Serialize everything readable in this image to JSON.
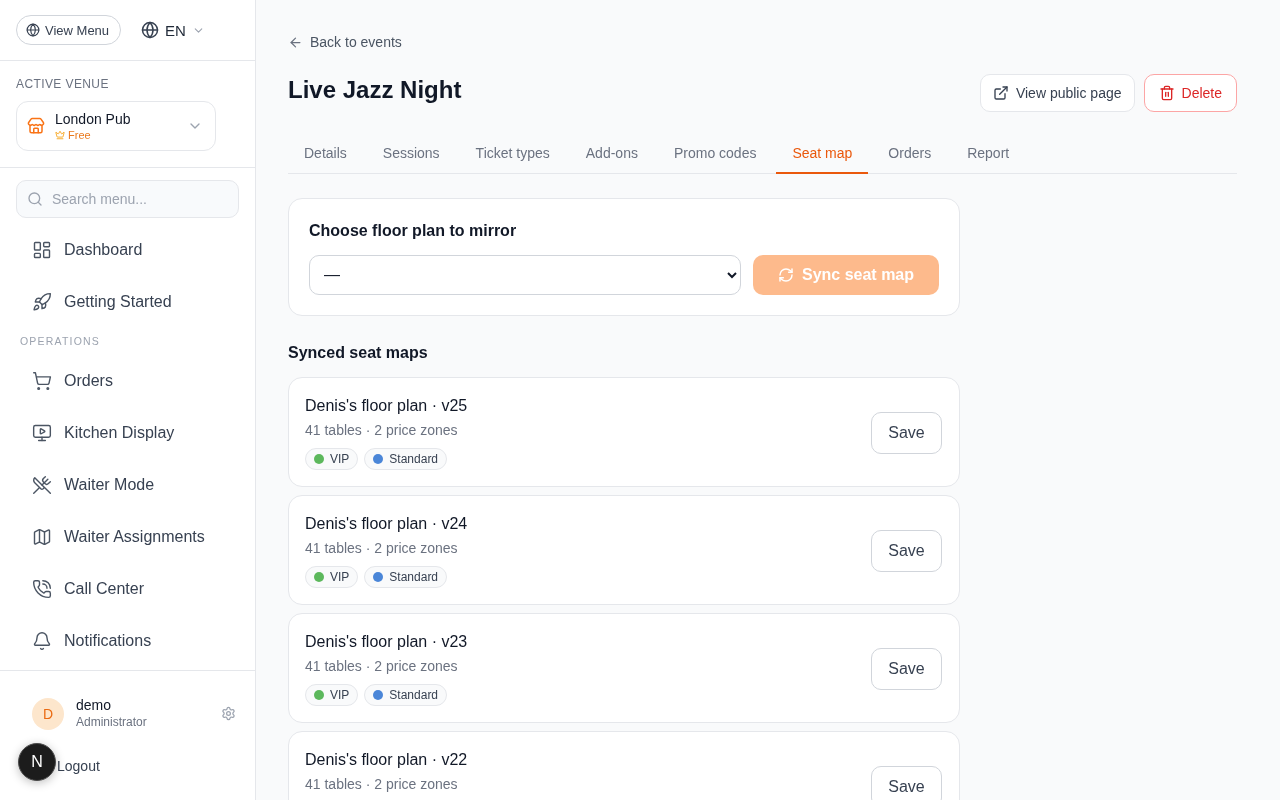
{
  "sidebar": {
    "view_menu_button": {
      "label": "View Menu"
    },
    "language": {
      "label": "EN"
    },
    "venue": {
      "heading": "ACTIVE VENUE",
      "name": "London Pub",
      "plan": "Free"
    },
    "search": {
      "placeholder": "Search menu..."
    },
    "sections": [
      {
        "items": [
          {
            "label": "Dashboard",
            "selected": false
          },
          {
            "label": "Getting Started",
            "selected": false
          }
        ]
      },
      {
        "heading": "OPERATIONS",
        "items": [
          {
            "label": "Orders",
            "selected": false
          },
          {
            "label": "Kitchen Display",
            "selected": false
          },
          {
            "label": "Waiter Mode",
            "selected": false
          },
          {
            "label": "Waiter Assignments",
            "selected": false
          },
          {
            "label": "Call Center",
            "selected": false
          },
          {
            "label": "Notifications",
            "selected": false
          }
        ]
      }
    ],
    "user": {
      "initial": "D",
      "name": "demo",
      "role": "Administrator"
    },
    "logout": {
      "label": "Logout"
    }
  },
  "dev_badge": {
    "label": "N"
  },
  "main": {
    "back_link": "Back to events",
    "title": "Live Jazz Night",
    "actions": [
      {
        "kind": "secondary",
        "label": "View public page"
      },
      {
        "kind": "danger",
        "label": "Delete"
      }
    ],
    "tabs": [
      {
        "label": "Details",
        "selected": false
      },
      {
        "label": "Sessions",
        "selected": false
      },
      {
        "label": "Ticket types",
        "selected": false
      },
      {
        "label": "Add-ons",
        "selected": false
      },
      {
        "label": "Promo codes",
        "selected": false
      },
      {
        "label": "Seat map",
        "selected": true
      },
      {
        "label": "Orders",
        "selected": false
      },
      {
        "label": "Report",
        "selected": false
      }
    ],
    "mirror_card": {
      "label": "Choose floor plan to mirror",
      "select_value": "—",
      "sync_button": {
        "label": "Sync seat map",
        "disabled": true
      }
    },
    "synced_heading": "Synced seat maps",
    "seat_maps": [
      {
        "title": "Denis's floor plan · v25",
        "summary": "41 tables · 2 price zones",
        "zones": [
          {
            "name": "VIP",
            "color": "#5cb85c"
          },
          {
            "name": "Standard",
            "color": "#4a86d8"
          }
        ],
        "save_label": "Save"
      },
      {
        "title": "Denis's floor plan · v24",
        "summary": "41 tables · 2 price zones",
        "zones": [
          {
            "name": "VIP",
            "color": "#5cb85c"
          },
          {
            "name": "Standard",
            "color": "#4a86d8"
          }
        ],
        "save_label": "Save"
      },
      {
        "title": "Denis's floor plan · v23",
        "summary": "41 tables · 2 price zones",
        "zones": [
          {
            "name": "VIP",
            "color": "#5cb85c"
          },
          {
            "name": "Standard",
            "color": "#4a86d8"
          }
        ],
        "save_label": "Save"
      },
      {
        "title": "Denis's floor plan · v22",
        "summary": "41 tables · 2 price zones",
        "save_label": "Save"
      }
    ]
  }
}
